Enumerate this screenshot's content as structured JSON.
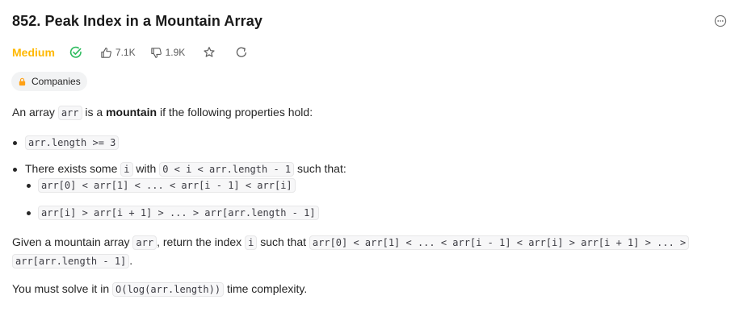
{
  "problem": {
    "title": "852. Peak Index in a Mountain Array",
    "difficulty": "Medium",
    "likes": "7.1K",
    "dislikes": "1.9K",
    "companies_label": "Companies"
  },
  "description": {
    "p1_a": "An array",
    "p1_code": "arr",
    "p1_b": "is a",
    "p1_bold": "mountain",
    "p1_c": "if the following properties hold:",
    "b1_code": "arr.length >= 3",
    "b2_a": "There exists some",
    "b2_code1": "i",
    "b2_b": "with",
    "b2_code2": "0 < i < arr.length - 1",
    "b2_c": "such that:",
    "sb1_code": "arr[0] < arr[1] < ... < arr[i - 1] < arr[i]",
    "sb2_code": "arr[i] > arr[i + 1] > ... > arr[arr.length - 1]",
    "p2_a": "Given a mountain array",
    "p2_code1": "arr",
    "p2_b": ", return the index",
    "p2_code2": "i",
    "p2_c": "such that",
    "p2_code3": "arr[0] < arr[1] < ... < arr[i - 1] < arr[i] > arr[i + 1] > ... >",
    "p2_code4": "arr[arr.length - 1]",
    "p2_d": ".",
    "p3_a": "You must solve it in",
    "p3_code": "O(log(arr.length))",
    "p3_b": "time complexity."
  },
  "colors": {
    "difficulty_medium": "#ffb800",
    "solved_green": "#2cbb5d"
  },
  "icons": [
    "solved-check-icon",
    "thumbs-up-icon",
    "thumbs-down-icon",
    "star-icon",
    "share-icon",
    "lock-icon",
    "more-options-icon"
  ]
}
